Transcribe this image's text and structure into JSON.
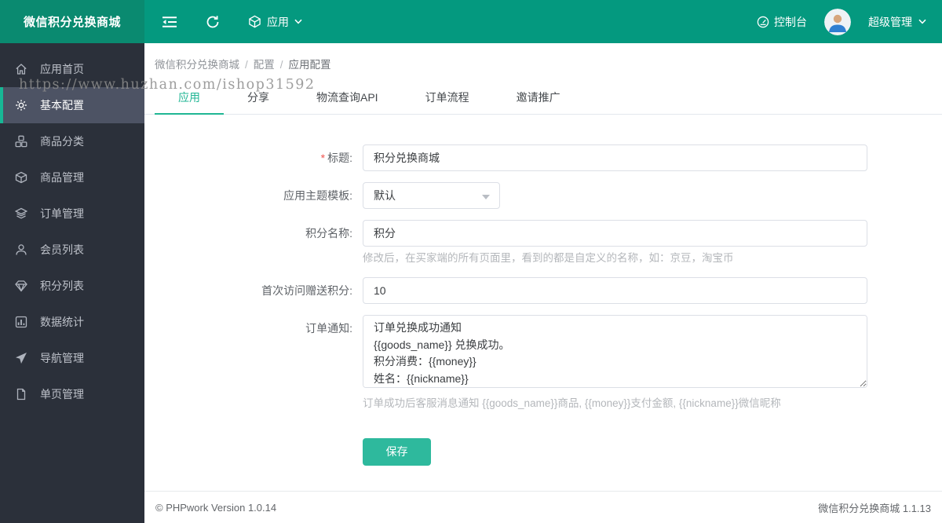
{
  "header": {
    "app_title": "微信积分兑换商城",
    "nav_app_label": "应用",
    "console_label": "控制台",
    "user_label": "超级管理"
  },
  "sidebar": {
    "items": [
      {
        "label": "应用首页",
        "icon": "home-icon",
        "active": false
      },
      {
        "label": "基本配置",
        "icon": "gear-icon",
        "active": true
      },
      {
        "label": "商品分类",
        "icon": "category-icon",
        "active": false
      },
      {
        "label": "商品管理",
        "icon": "box-icon",
        "active": false
      },
      {
        "label": "订单管理",
        "icon": "layers-icon",
        "active": false
      },
      {
        "label": "会员列表",
        "icon": "user-icon",
        "active": false
      },
      {
        "label": "积分列表",
        "icon": "gem-icon",
        "active": false
      },
      {
        "label": "数据统计",
        "icon": "chart-icon",
        "active": false
      },
      {
        "label": "导航管理",
        "icon": "navigation-icon",
        "active": false
      },
      {
        "label": "单页管理",
        "icon": "page-icon",
        "active": false
      }
    ]
  },
  "breadcrumb": {
    "separator": "/",
    "items": [
      "微信积分兑换商城",
      "配置",
      "应用配置"
    ]
  },
  "tabs": [
    {
      "label": "应用",
      "active": true
    },
    {
      "label": "分享",
      "active": false
    },
    {
      "label": "物流查询API",
      "active": false
    },
    {
      "label": "订单流程",
      "active": false
    },
    {
      "label": "邀请推广",
      "active": false
    }
  ],
  "form": {
    "fields": [
      {
        "label": "标题:",
        "required": true,
        "type": "input",
        "value": "积分兑换商城",
        "hint": ""
      },
      {
        "label": "应用主题模板:",
        "required": false,
        "type": "select",
        "value": "默认",
        "hint": ""
      },
      {
        "label": "积分名称:",
        "required": false,
        "type": "input",
        "value": "积分",
        "hint": "修改后，在买家端的所有页面里，看到的都是自定义的名称，如：京豆，淘宝币"
      },
      {
        "label": "首次访问赠送积分:",
        "required": false,
        "type": "input",
        "value": "10",
        "hint": ""
      },
      {
        "label": "订单通知:",
        "required": false,
        "type": "textarea",
        "value": "订单兑换成功通知\n{{goods_name}} 兑换成功。\n积分消费：{{money}}\n姓名：{{nickname}}",
        "hint": "订单成功后客服消息通知 {{goods_name}}商品, {{money}}支付金额, {{nickname}}微信昵称"
      }
    ],
    "save_label": "保存"
  },
  "watermark": "https://www.huzhan.com/ishop31592",
  "footer": {
    "left": "© PHPwork Version 1.0.14",
    "right": "微信积分兑换商城 1.1.13"
  },
  "colors": {
    "header": "#04997f",
    "header_dark": "#0a8a70",
    "sidebar": "#2b303a",
    "sidebar_active_bg": "#4d5364",
    "accent": "#20b694",
    "save_button": "#2eb99d",
    "required_star": "#f0544f"
  }
}
